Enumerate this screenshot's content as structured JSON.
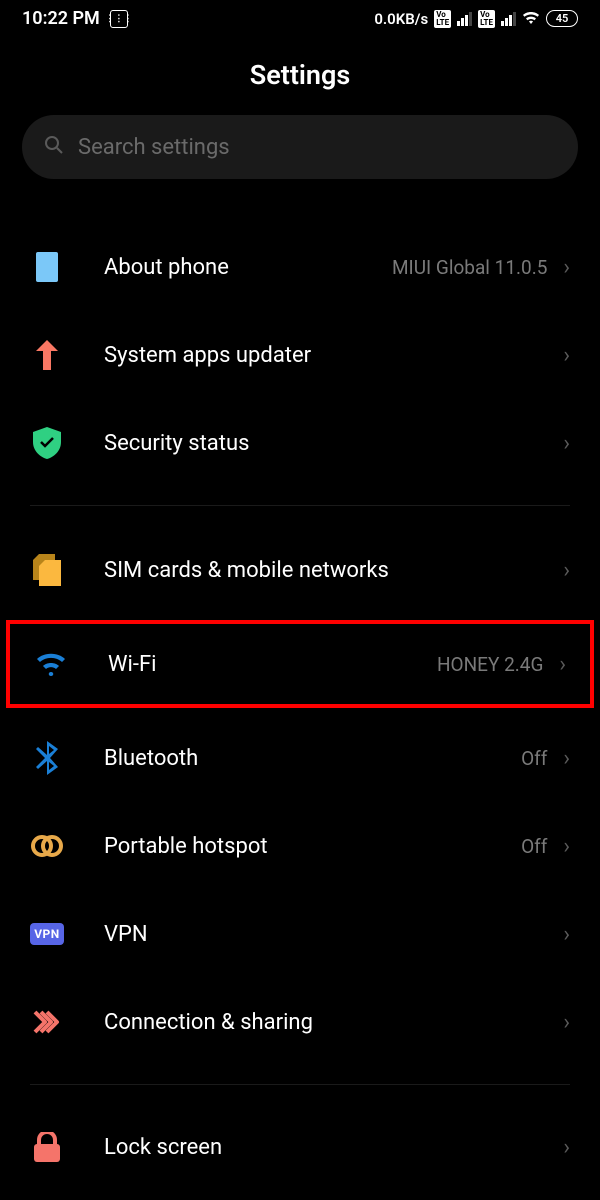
{
  "status": {
    "time": "10:22 PM",
    "dataRate": "0.0KB/s",
    "battery": "45"
  },
  "header": {
    "title": "Settings"
  },
  "search": {
    "placeholder": "Search settings"
  },
  "rows": {
    "about": {
      "label": "About phone",
      "value": "MIUI Global 11.0.5"
    },
    "updater": {
      "label": "System apps updater",
      "value": ""
    },
    "security": {
      "label": "Security status",
      "value": ""
    },
    "sim": {
      "label": "SIM cards & mobile networks",
      "value": ""
    },
    "wifi": {
      "label": "Wi-Fi",
      "value": "HONEY 2.4G"
    },
    "bluetooth": {
      "label": "Bluetooth",
      "value": "Off"
    },
    "hotspot": {
      "label": "Portable hotspot",
      "value": "Off"
    },
    "vpn": {
      "label": "VPN",
      "value": ""
    },
    "connection": {
      "label": "Connection & sharing",
      "value": ""
    },
    "lock": {
      "label": "Lock screen",
      "value": ""
    }
  }
}
